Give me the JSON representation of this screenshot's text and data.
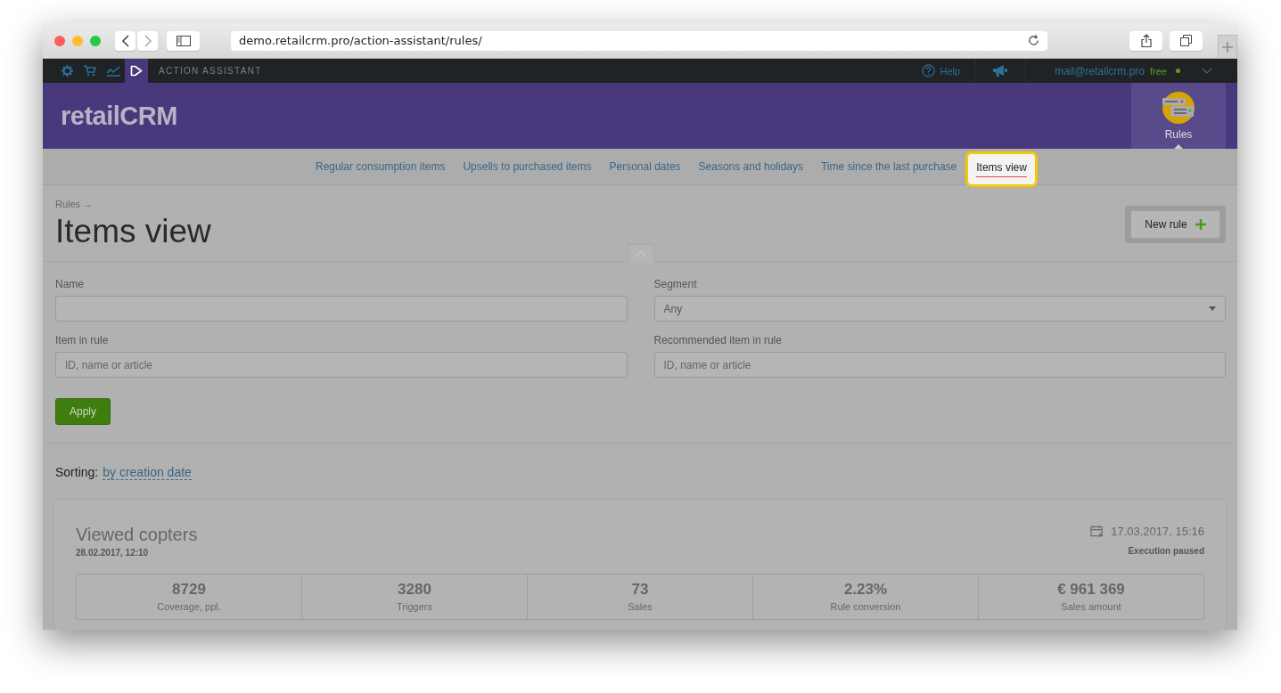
{
  "browser": {
    "url": "demo.retailcrm.pro/action-assistant/rules/"
  },
  "topbar": {
    "icons": [
      {
        "kind": "gear",
        "selected": false
      },
      {
        "kind": "cart",
        "selected": false
      },
      {
        "kind": "chart",
        "selected": false
      },
      {
        "kind": "play",
        "selected": true
      }
    ],
    "section": "ACTION ASSISTANT",
    "help": "Help",
    "email": "mail@retailcrm.pro",
    "plan": "free"
  },
  "header": {
    "logo": "retailCRM",
    "module": "Rules"
  },
  "tabs": [
    {
      "label": "Regular consumption items",
      "selected": false
    },
    {
      "label": "Upsells to purchased items",
      "selected": false
    },
    {
      "label": "Personal dates",
      "selected": false
    },
    {
      "label": "Seasons and holidays",
      "selected": false
    },
    {
      "label": "Time since the last purchase",
      "selected": false
    },
    {
      "label": "Items view",
      "selected": true
    }
  ],
  "page": {
    "breadcrumb": "Rules →",
    "title": "Items view",
    "new_rule": "New rule"
  },
  "filters": [
    {
      "kind": "text",
      "label": "Name"
    },
    {
      "kind": "select",
      "label": "Segment",
      "value": "Any"
    },
    {
      "kind": "text",
      "label": "Item in rule",
      "placeholder": "ID, name or article"
    },
    {
      "kind": "text",
      "label": "Recommended item in rule",
      "placeholder": "ID, name or article"
    }
  ],
  "filters_expanded": true,
  "apply": "Apply",
  "sorting": {
    "label": "Sorting:",
    "value": "by creation date"
  },
  "rules": [
    {
      "name": "Viewed copters",
      "created": "28.02.2017, 12:10",
      "executed": "17.03.2017, 15:16",
      "status": "Execution paused",
      "stats": [
        {
          "value": "8729",
          "label": "Coverage, ppl."
        },
        {
          "value": "3280",
          "label": "Triggers"
        },
        {
          "value": "73",
          "label": "Sales"
        },
        {
          "value": "2.23%",
          "label": "Rule conversion"
        },
        {
          "value": "€ 961 369",
          "label": "Sales amount"
        }
      ]
    }
  ]
}
